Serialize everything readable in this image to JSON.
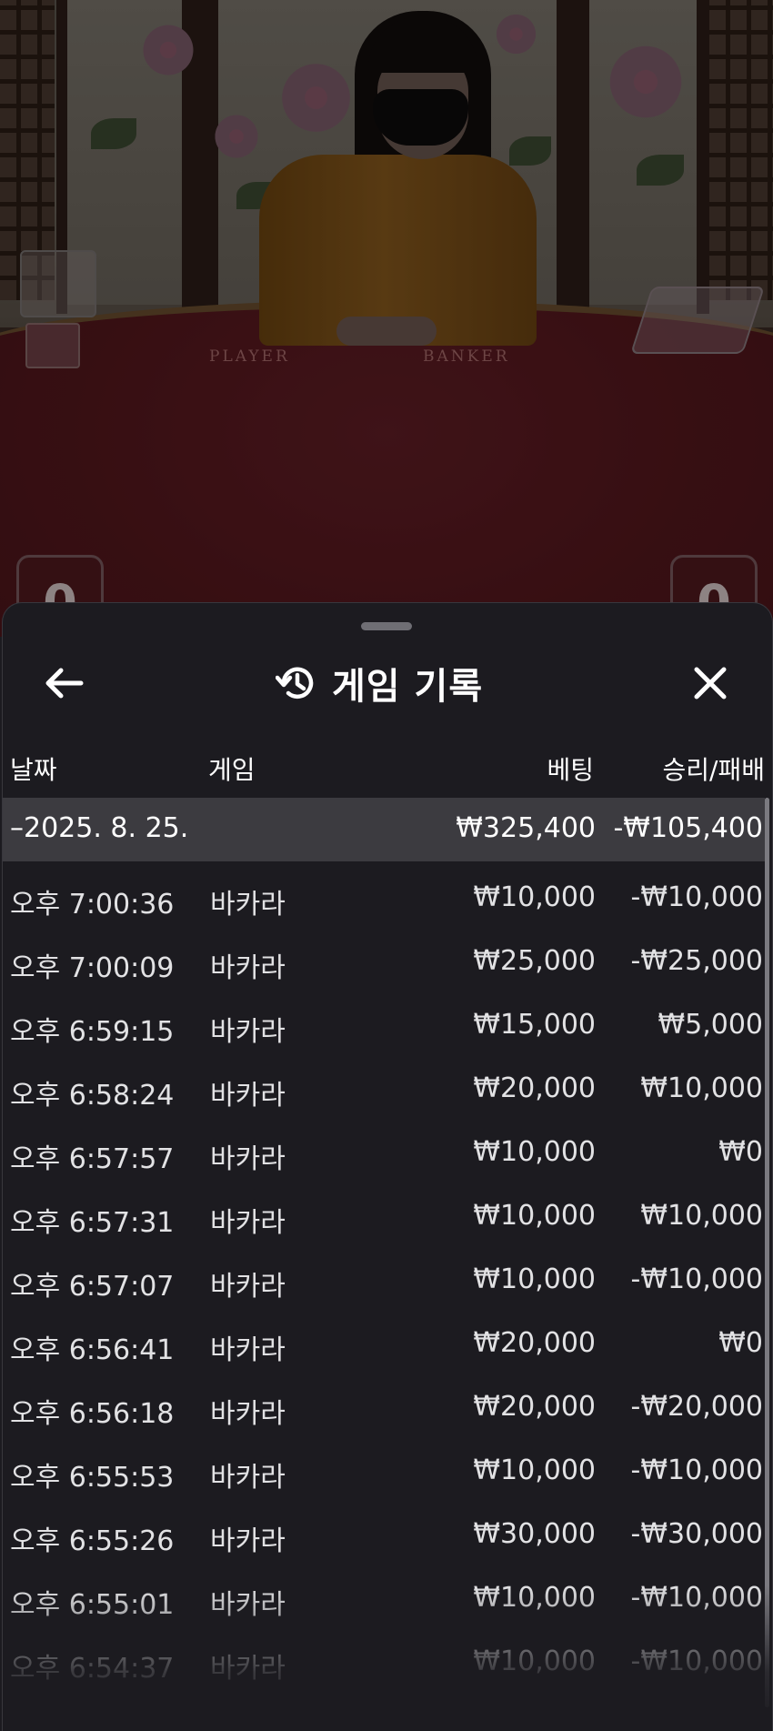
{
  "video": {
    "felt_labels": [
      "PLAYER",
      "BANKER"
    ],
    "scores": [
      "0",
      "0"
    ]
  },
  "sheet": {
    "title": "게임 기록",
    "title_icon": "history-icon",
    "back_icon": "arrow-left-icon",
    "close_icon": "close-icon"
  },
  "columns": {
    "date": "날짜",
    "game": "게임",
    "bet": "베팅",
    "result": "승리/패배"
  },
  "summary": {
    "date": "–2025. 8. 25.",
    "bet": "₩325,400",
    "result": "-₩105,400"
  },
  "rows": [
    {
      "time": "오후 7:00:36",
      "game": "바카라",
      "bet": "₩10,000",
      "result": "-₩10,000"
    },
    {
      "time": "오후 7:00:09",
      "game": "바카라",
      "bet": "₩25,000",
      "result": "-₩25,000"
    },
    {
      "time": "오후 6:59:15",
      "game": "바카라",
      "bet": "₩15,000",
      "result": "₩5,000"
    },
    {
      "time": "오후 6:58:24",
      "game": "바카라",
      "bet": "₩20,000",
      "result": "₩10,000"
    },
    {
      "time": "오후 6:57:57",
      "game": "바카라",
      "bet": "₩10,000",
      "result": "₩0"
    },
    {
      "time": "오후 6:57:31",
      "game": "바카라",
      "bet": "₩10,000",
      "result": "₩10,000"
    },
    {
      "time": "오후 6:57:07",
      "game": "바카라",
      "bet": "₩10,000",
      "result": "-₩10,000"
    },
    {
      "time": "오후 6:56:41",
      "game": "바카라",
      "bet": "₩20,000",
      "result": "₩0"
    },
    {
      "time": "오후 6:56:18",
      "game": "바카라",
      "bet": "₩20,000",
      "result": "-₩20,000"
    },
    {
      "time": "오후 6:55:53",
      "game": "바카라",
      "bet": "₩10,000",
      "result": "-₩10,000"
    },
    {
      "time": "오후 6:55:26",
      "game": "바카라",
      "bet": "₩30,000",
      "result": "-₩30,000"
    },
    {
      "time": "오후 6:55:01",
      "game": "바카라",
      "bet": "₩10,000",
      "result": "-₩10,000"
    },
    {
      "time": "오후 6:54:37",
      "game": "바카라",
      "bet": "₩10,000",
      "result": "-₩10,000"
    }
  ]
}
